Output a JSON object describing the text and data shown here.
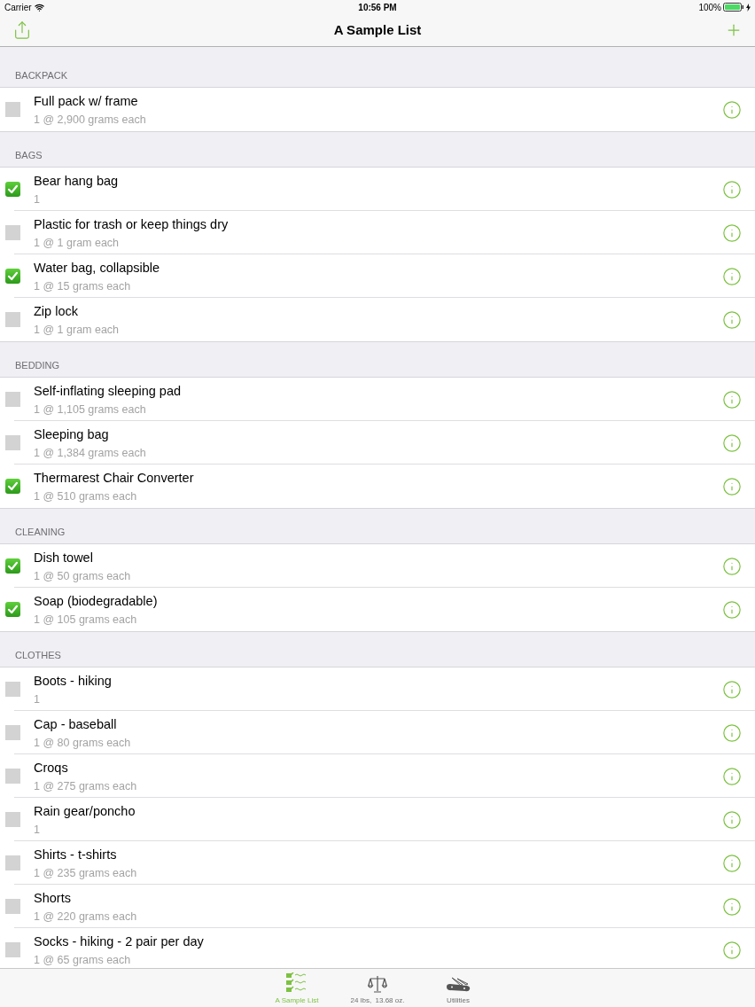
{
  "status_bar": {
    "carrier": "Carrier",
    "time": "10:56 PM",
    "battery": "100%"
  },
  "nav_bar": {
    "title": "A Sample List"
  },
  "sections": [
    {
      "title": "BACKPACK",
      "items": [
        {
          "name": "Full pack w/ frame",
          "detail": "1 @ 2,900 grams each",
          "checked": false
        }
      ]
    },
    {
      "title": "BAGS",
      "items": [
        {
          "name": "Bear hang bag",
          "detail": "1",
          "checked": true
        },
        {
          "name": "Plastic for trash or keep things dry",
          "detail": "1 @ 1 gram each",
          "checked": false
        },
        {
          "name": "Water bag, collapsible",
          "detail": "1 @ 15 grams each",
          "checked": true
        },
        {
          "name": "Zip lock",
          "detail": "1 @ 1 gram each",
          "checked": false
        }
      ]
    },
    {
      "title": "BEDDING",
      "items": [
        {
          "name": "Self-inflating sleeping pad",
          "detail": "1 @ 1,105 grams each",
          "checked": false
        },
        {
          "name": "Sleeping bag",
          "detail": "1 @ 1,384 grams each",
          "checked": false
        },
        {
          "name": "Thermarest Chair Converter",
          "detail": "1 @ 510 grams each",
          "checked": true
        }
      ]
    },
    {
      "title": "CLEANING",
      "items": [
        {
          "name": "Dish towel",
          "detail": "1 @ 50 grams each",
          "checked": true
        },
        {
          "name": "Soap (biodegradable)",
          "detail": "1 @ 105 grams each",
          "checked": true
        }
      ]
    },
    {
      "title": "CLOTHES",
      "items": [
        {
          "name": "Boots - hiking",
          "detail": "1",
          "checked": false
        },
        {
          "name": "Cap - baseball",
          "detail": "1 @ 80 grams each",
          "checked": false
        },
        {
          "name": "Croqs",
          "detail": "1 @ 275 grams each",
          "checked": false
        },
        {
          "name": "Rain gear/poncho",
          "detail": "1",
          "checked": false
        },
        {
          "name": "Shirts - t-shirts",
          "detail": "1 @ 235 grams each",
          "checked": false
        },
        {
          "name": "Shorts",
          "detail": "1 @ 220 grams each",
          "checked": false
        },
        {
          "name": "Socks - hiking - 2 pair per day",
          "detail": "1 @ 65 grams each",
          "checked": false
        }
      ]
    }
  ],
  "tab_bar": [
    {
      "kind": "checklist",
      "label": "A Sample List",
      "selected": true
    },
    {
      "kind": "scale",
      "label": "24 lbs,  13.68 oz.",
      "selected": false
    },
    {
      "kind": "knife",
      "label": "Utilities",
      "selected": false
    }
  ]
}
